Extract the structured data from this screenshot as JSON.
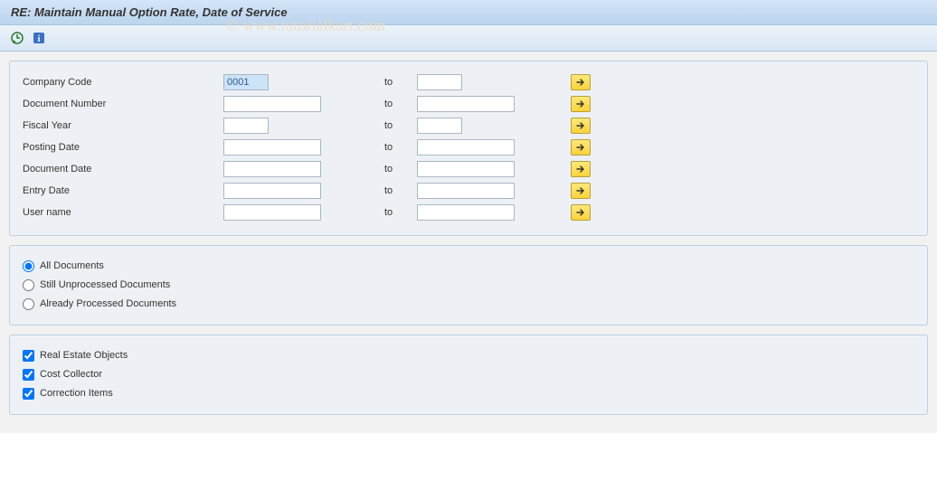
{
  "title": "RE: Maintain Manual Option Rate, Date of Service",
  "watermark": "© www.tutorialkart.com",
  "toolbar": {
    "execute_icon": "execute",
    "info_icon": "info"
  },
  "selection": {
    "rows": [
      {
        "label": "Company Code",
        "from": "0001",
        "to": "",
        "from_w": "short",
        "to_w": "short",
        "highlighted": true
      },
      {
        "label": "Document Number",
        "from": "",
        "to": "",
        "from_w": "med",
        "to_w": "med",
        "highlighted": false
      },
      {
        "label": "Fiscal Year",
        "from": "",
        "to": "",
        "from_w": "short",
        "to_w": "short",
        "highlighted": false
      },
      {
        "label": "Posting Date",
        "from": "",
        "to": "",
        "from_w": "med",
        "to_w": "med",
        "highlighted": false
      },
      {
        "label": "Document Date",
        "from": "",
        "to": "",
        "from_w": "med",
        "to_w": "med",
        "highlighted": false
      },
      {
        "label": "Entry Date",
        "from": "",
        "to": "",
        "from_w": "med",
        "to_w": "med",
        "highlighted": false
      },
      {
        "label": "User name",
        "from": "",
        "to": "",
        "from_w": "med",
        "to_w": "med",
        "highlighted": false
      }
    ],
    "to_text": "to"
  },
  "doc_filter": {
    "options": [
      {
        "label": "All Documents",
        "checked": true
      },
      {
        "label": "Still Unprocessed Documents",
        "checked": false
      },
      {
        "label": "Already Processed Documents",
        "checked": false
      }
    ]
  },
  "object_types": {
    "items": [
      {
        "label": "Real Estate Objects",
        "checked": true
      },
      {
        "label": "Cost Collector",
        "checked": true
      },
      {
        "label": "Correction Items",
        "checked": true
      }
    ]
  }
}
